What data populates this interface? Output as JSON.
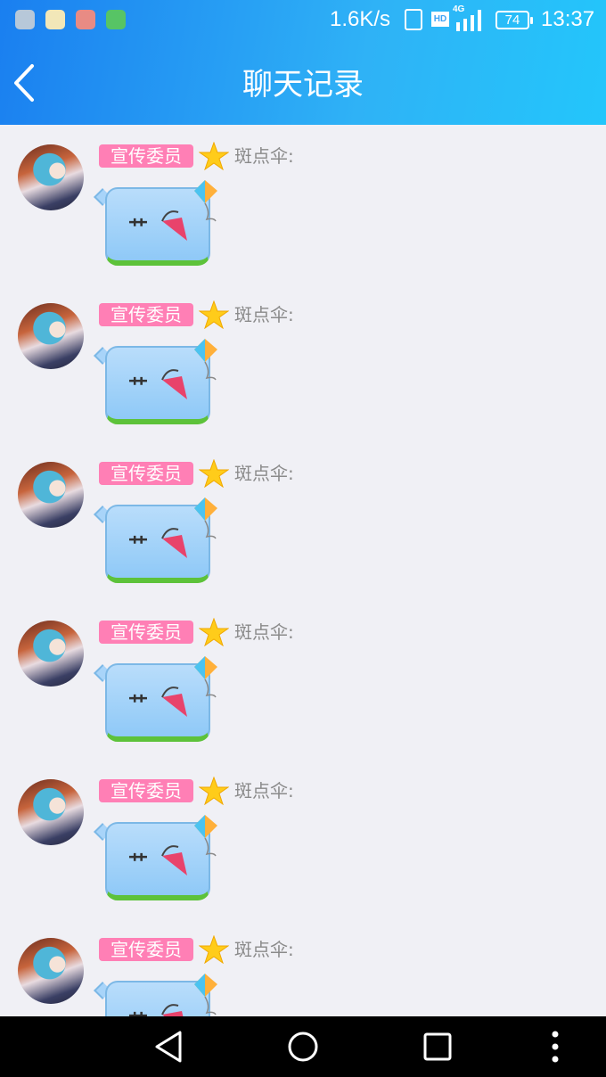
{
  "status_bar": {
    "net_speed": "1.6K/s",
    "hd_label": "HD",
    "network_label": "4G",
    "battery": "74",
    "time": "13:37",
    "notification_icons": [
      "gallery-icon",
      "star-app-icon",
      "weibo-icon",
      "wechat-icon"
    ]
  },
  "header": {
    "title": "聊天记录",
    "back_icon": "chevron-left-icon"
  },
  "messages": [
    {
      "role_badge": "宣传委员",
      "sender": "斑点伞:",
      "content": "艹",
      "sticker": "umbrella"
    },
    {
      "role_badge": "宣传委员",
      "sender": "斑点伞:",
      "content": "艹",
      "sticker": "umbrella"
    },
    {
      "role_badge": "宣传委员",
      "sender": "斑点伞:",
      "content": "艹",
      "sticker": "umbrella"
    },
    {
      "role_badge": "宣传委员",
      "sender": "斑点伞:",
      "content": "艹",
      "sticker": "umbrella"
    },
    {
      "role_badge": "宣传委员",
      "sender": "斑点伞:",
      "content": "艹",
      "sticker": "umbrella"
    },
    {
      "role_badge": "宣传委员",
      "sender": "斑点伞:",
      "content": "艹",
      "sticker": "umbrella"
    }
  ],
  "colors": {
    "header_start": "#1a7ff0",
    "header_end": "#23c6fb",
    "badge": "#ff7fb5",
    "background": "#f0f0f5"
  },
  "nav_bar": {
    "buttons": [
      "back-triangle-icon",
      "home-circle-icon",
      "recents-square-icon",
      "more-dots-icon"
    ]
  }
}
